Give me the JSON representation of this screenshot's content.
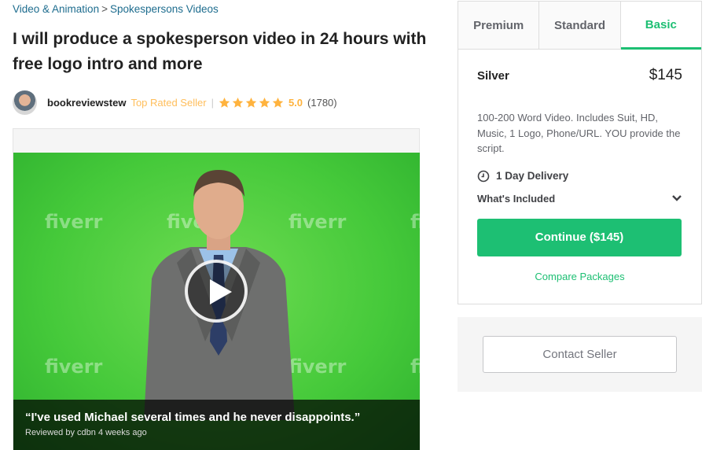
{
  "breadcrumb": {
    "item1": "Video & Animation",
    "separator": ">",
    "item2": "Spokespersons Videos"
  },
  "gig": {
    "title": "I will produce a spokesperson video in 24 hours with free logo intro and more"
  },
  "seller": {
    "name": "bookreviewstew",
    "level": "Top Rated Seller",
    "divider": "|",
    "rating": "5.0",
    "reviews_count": "(1780)",
    "stars": 5
  },
  "media": {
    "watermark": "fiverr",
    "review_quote": "“I've used Michael several times and he never disappoints.”",
    "review_meta": "Reviewed by cdbn 4 weeks ago"
  },
  "packages": {
    "tabs": [
      "Premium",
      "Standard",
      "Basic"
    ],
    "active_tab": "Basic",
    "name": "Silver",
    "price": "$145",
    "description": "100-200 Word Video. Includes Suit, HD, Music, 1 Logo, Phone/URL. YOU provide the script.",
    "delivery": "1 Day Delivery",
    "included_label": "What's Included",
    "continue_label": "Continue ($145)",
    "compare_label": "Compare Packages"
  },
  "contact": {
    "label": "Contact Seller"
  },
  "colors": {
    "accent": "#1dbf73",
    "link": "#1d6c8e",
    "star": "#ffbe5b"
  }
}
